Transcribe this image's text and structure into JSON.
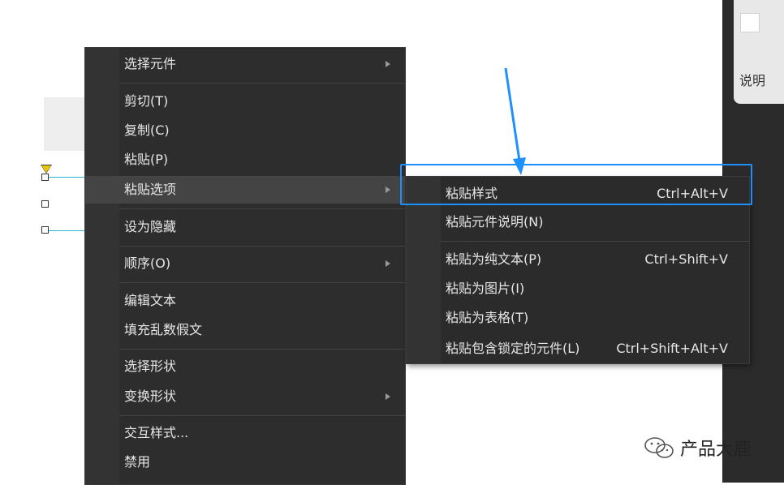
{
  "right_panel": {
    "label": "说明"
  },
  "context_menu": {
    "items": [
      {
        "label": "选择元件",
        "submenu": true
      },
      {
        "label": "剪切(T)",
        "submenu": false
      },
      {
        "label": "复制(C)",
        "submenu": false
      },
      {
        "label": "粘贴(P)",
        "submenu": false
      },
      {
        "label": "粘贴选项",
        "submenu": true,
        "highlighted": true
      },
      {
        "label": "设为隐藏",
        "submenu": false
      },
      {
        "label": "顺序(O)",
        "submenu": true
      },
      {
        "label": "编辑文本",
        "submenu": false
      },
      {
        "label": "填充乱数假文",
        "submenu": false
      },
      {
        "label": "选择形状",
        "submenu": false
      },
      {
        "label": "变换形状",
        "submenu": true
      },
      {
        "label": "交互样式...",
        "submenu": false
      },
      {
        "label": "禁用",
        "submenu": false
      }
    ]
  },
  "paste_submenu": {
    "items": [
      {
        "label": "粘贴样式",
        "shortcut": "Ctrl+Alt+V"
      },
      {
        "label": "粘贴元件说明(N)",
        "shortcut": ""
      },
      {
        "label": "粘贴为纯文本(P)",
        "shortcut": "Ctrl+Shift+V"
      },
      {
        "label": "粘贴为图片(I)",
        "shortcut": ""
      },
      {
        "label": "粘贴为表格(T)",
        "shortcut": ""
      },
      {
        "label": "粘贴包含锁定的元件(L)",
        "shortcut": "Ctrl+Shift+Alt+V"
      }
    ]
  },
  "watermark": {
    "text": "产品大鹿",
    "icon": "wechat-icon"
  },
  "colors": {
    "menu_bg": "#2d2d2d",
    "highlight": "#444444",
    "annotation": "#1e90ff",
    "selection": "#29b6d6"
  }
}
